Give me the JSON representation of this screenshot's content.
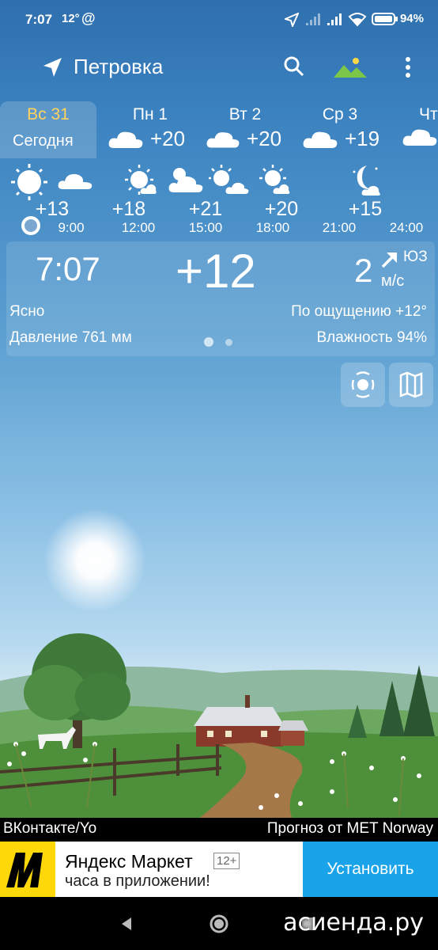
{
  "status": {
    "time": "7:07",
    "temp": "12°",
    "at": "@",
    "battery": "94%"
  },
  "topbar": {
    "location": "Петровка",
    "icons": [
      "location-arrow-icon",
      "search-icon",
      "landscape-icon",
      "more-vert-icon"
    ]
  },
  "days": [
    {
      "name": "Вс 31",
      "sub": "Сегодня",
      "selected": true
    },
    {
      "name": "Пн 1",
      "temp": "+20",
      "icon": "cloud-icon"
    },
    {
      "name": "Вт 2",
      "temp": "+20",
      "icon": "cloud-icon"
    },
    {
      "name": "Ср 3",
      "temp": "+19",
      "icon": "cloud-icon"
    },
    {
      "name": "Чт",
      "temp": "",
      "icon": "cloud-icon"
    }
  ],
  "hourly": [
    {
      "temp": "+13",
      "time": "9:00",
      "icon": "sun-icon"
    },
    {
      "temp": "+18",
      "time": "12:00",
      "icon": "sun-icon"
    },
    {
      "temp": "+21",
      "time": "15:00",
      "icon": "sun-cloud-icon"
    },
    {
      "temp": "+20",
      "time": "18:00",
      "icon": "sun-cloud-icon"
    },
    {
      "temp": "+15",
      "time": "21:00",
      "icon": "moon-cloud-icon"
    },
    {
      "temp": "",
      "time": "24:00",
      "icon": "none"
    }
  ],
  "current": {
    "time": "7:07",
    "temp": "+12",
    "wind_speed": "2",
    "wind_unit": "м/с",
    "wind_dir": "ЮЗ",
    "condition": "Ясно",
    "feels_like": "По ощущению +12°",
    "pressure": "Давление 761 мм",
    "humidity": "Влажность 94%"
  },
  "source": {
    "left": "ВКонтакте/Yo",
    "right": "Прогноз от MET Norway"
  },
  "ad": {
    "title": "Яндекс Маркет",
    "age": "12+",
    "subtitle": "часа в приложении!",
    "button": "Установить"
  },
  "watermark": "асиенда.ру",
  "colors": {
    "selected_day": "#ffd35a",
    "install_button": "#1aa3e8",
    "ad_logo": "#ffd80a"
  }
}
